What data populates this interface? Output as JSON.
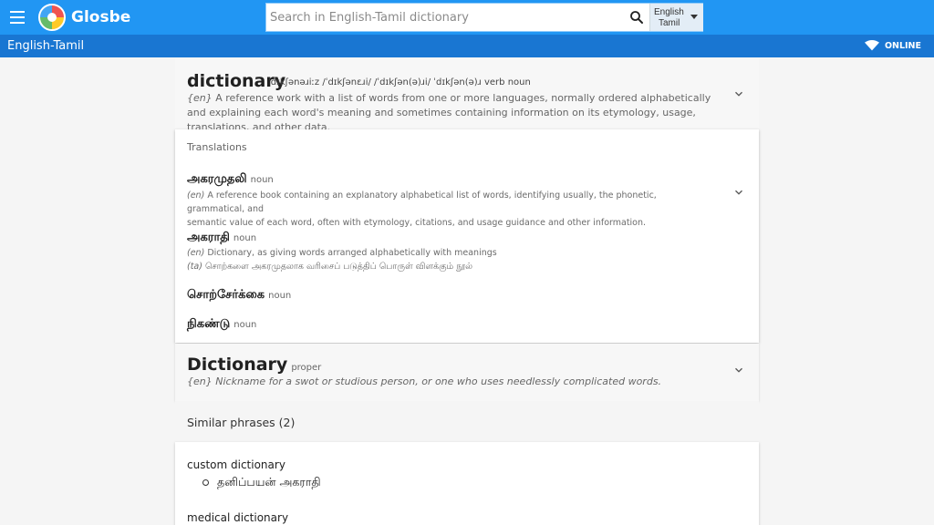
{
  "header": {
    "brand": "Glosbe",
    "search_placeholder": "Search in English-Tamil dictionary",
    "lang_line1": "English",
    "lang_line2": "Tamil"
  },
  "subbar": {
    "title": "English-Tamil",
    "status": "ONLINE"
  },
  "entry": {
    "word": "dictionary",
    "pronunciations": "ˈdɪkʃənəɹiːz   /ˈdɪkʃənɛɹi/   /ˈdɪkʃən(ə)ɹi/   ˈdɪkʃən(ə)ɹ   verb   noun",
    "def_lang": "{en}",
    "definition": "A reference work with a list of words from one or more languages, normally ordered alphabetically and explaining each word's meaning and sometimes containing information on its etymology, usage, translations, and other data."
  },
  "translations": {
    "label": "Translations",
    "items": [
      {
        "word": "அகரமுதலி",
        "pos": "noun",
        "lines": [
          {
            "lang": "(en)",
            "text": "A reference book containing an explanatory alphabetical list of words, identifying usually, the phonetic, grammatical, and"
          },
          {
            "lang": "",
            "text": "semantic value of each word, often with etymology, citations, and usage guidance and other information."
          }
        ]
      },
      {
        "word": "அகராதி",
        "pos": "noun",
        "lines": [
          {
            "lang": "(en)",
            "text": "Dictionary, as giving words arranged alphabetically with meanings"
          },
          {
            "lang": "(ta)",
            "text": "சொற்களை அகரமுதலாக வரிசைப் படுத்திப் பொருள் விளக்கும் நூல்"
          }
        ]
      },
      {
        "word": "சொற்சேர்க்கை",
        "pos": "noun",
        "lines": []
      },
      {
        "word": "நிகண்டு",
        "pos": "noun",
        "lines": []
      }
    ]
  },
  "proper": {
    "word": "Dictionary",
    "pos": "proper",
    "def_lang": "{en}",
    "definition": "Nickname for a swot or studious person, or one who uses needlessly complicated words."
  },
  "similar": {
    "title": "Similar phrases (2)",
    "items": [
      {
        "phrase": "custom dictionary",
        "translation": "தனிப்பயன் அகராதி"
      },
      {
        "phrase": "medical dictionary",
        "translation": ""
      }
    ]
  },
  "colors": {
    "topbar": "#2196f3",
    "subbar": "#1976d2"
  }
}
